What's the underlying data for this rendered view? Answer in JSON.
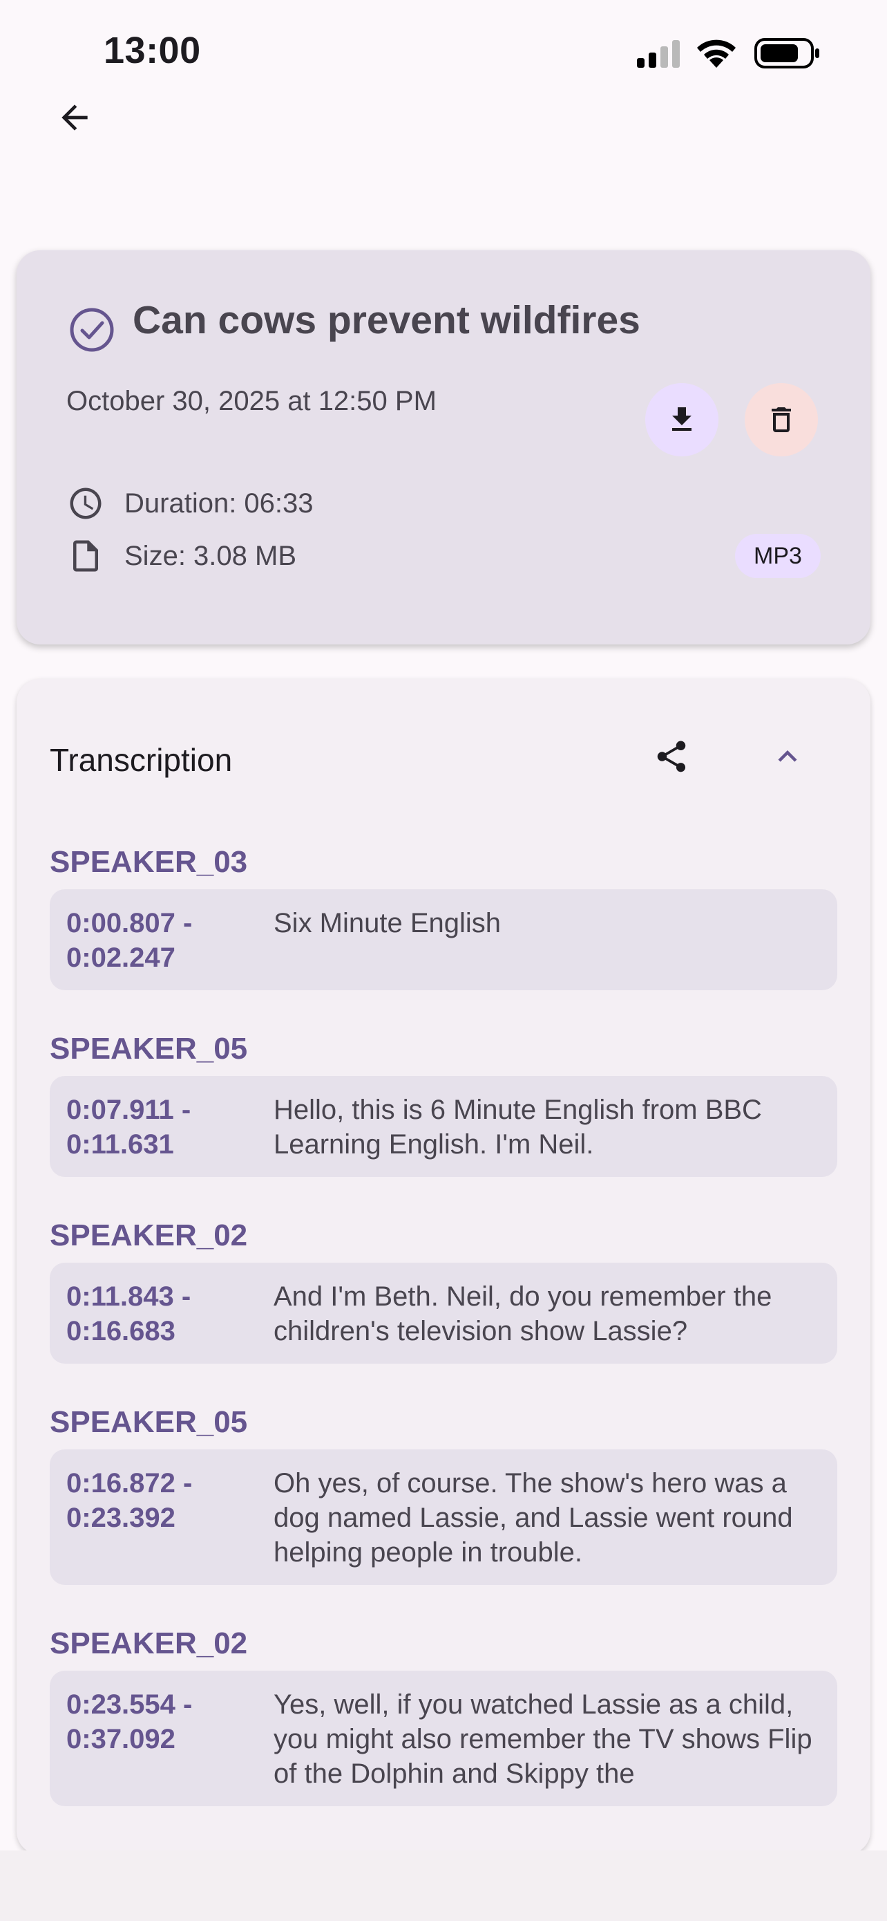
{
  "status_bar": {
    "time": "13:00"
  },
  "recording": {
    "title": "Can cows prevent wildfires",
    "date": "October 30, 2025 at 12:50 PM",
    "duration": "Duration: 06:33",
    "size": "Size: 3.08 MB",
    "format": "MP3"
  },
  "transcription": {
    "title": "Transcription",
    "segments": [
      {
        "speaker": "SPEAKER_03",
        "start": "0:00.807 -",
        "end": "0:02.247",
        "text": "Six Minute English"
      },
      {
        "speaker": "SPEAKER_05",
        "start": "0:07.911 -",
        "end": "0:11.631",
        "text": "Hello, this is 6 Minute English from BBC Learning English. I'm Neil."
      },
      {
        "speaker": "SPEAKER_02",
        "start": "0:11.843 -",
        "end": "0:16.683",
        "text": "And I'm Beth. Neil, do you remember the children's television show Lassie?"
      },
      {
        "speaker": "SPEAKER_05",
        "start": "0:16.872 -",
        "end": "0:23.392",
        "text": "Oh yes, of course. The show's hero was a dog named Lassie, and Lassie went round helping people in trouble."
      },
      {
        "speaker": "SPEAKER_02",
        "start": "0:23.554 -",
        "end": "0:37.092",
        "text": "Yes, well, if you watched Lassie as a child, you might also remember the TV shows Flip of the Dolphin and Skippy the"
      }
    ]
  },
  "colors": {
    "accent": "#65558f",
    "card": "#e6e0ea",
    "danger_bg": "#f9dedc",
    "primary_container": "#eaddff"
  }
}
